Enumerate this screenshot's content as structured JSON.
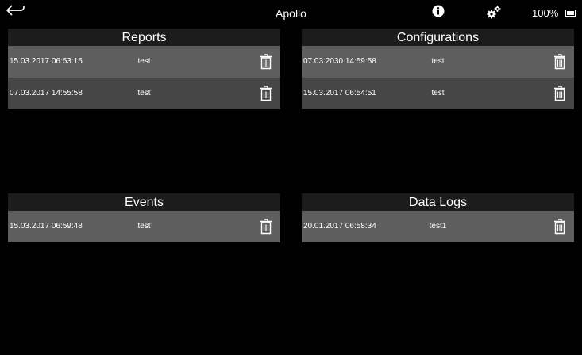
{
  "statusbar": {
    "app_title": "Apollo",
    "battery_percent": "100%",
    "icons": [
      "back-arrow-icon",
      "info-icon",
      "gears-icon",
      "battery-icon"
    ]
  },
  "panels": {
    "reports": {
      "title": "Reports",
      "rows": [
        {
          "date": "15.03.2017 06:53:15",
          "name": "test"
        },
        {
          "date": "07.03.2017 14:55:58",
          "name": "test"
        }
      ]
    },
    "configurations": {
      "title": "Configurations",
      "rows": [
        {
          "date": "07.03.2030 14:59:58",
          "name": "test"
        },
        {
          "date": "15.03.2017 06:54:51",
          "name": "test"
        }
      ]
    },
    "events": {
      "title": "Events",
      "rows": [
        {
          "date": "15.03.2017 06:59:48",
          "name": "test"
        }
      ]
    },
    "datalogs": {
      "title": "Data Logs",
      "rows": [
        {
          "date": "20.01.2017 06:58:34",
          "name": "test1"
        }
      ]
    }
  },
  "colors": {
    "background": "#000000",
    "header_bg": "#1c1c1c",
    "row_light": "#5e5e5e",
    "row_dark": "#464646"
  }
}
